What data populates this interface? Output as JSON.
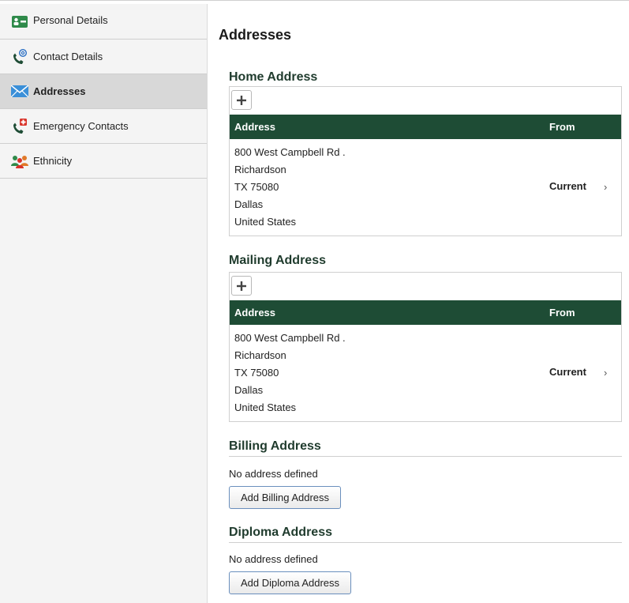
{
  "sidebar": {
    "items": [
      {
        "label": "Personal Details",
        "icon": "id-card-icon"
      },
      {
        "label": "Contact Details",
        "icon": "phone-at-icon"
      },
      {
        "label": "Addresses",
        "icon": "envelope-icon",
        "active": true
      },
      {
        "label": "Emergency Contacts",
        "icon": "phone-emergency-icon"
      },
      {
        "label": "Ethnicity",
        "icon": "people-icon"
      }
    ]
  },
  "main": {
    "title": "Addresses",
    "home": {
      "title": "Home Address",
      "col_address": "Address",
      "col_from": "From",
      "lines": [
        "800 West Campbell Rd .",
        "Richardson",
        "TX 75080",
        "Dallas",
        "United States"
      ],
      "from": "Current"
    },
    "mailing": {
      "title": "Mailing Address",
      "col_address": "Address",
      "col_from": "From",
      "lines": [
        "800 West Campbell Rd .",
        "Richardson",
        "TX 75080",
        "Dallas",
        "United States"
      ],
      "from": "Current"
    },
    "billing": {
      "title": "Billing Address",
      "empty_text": "No address defined",
      "button": "Add Billing Address"
    },
    "diploma": {
      "title": "Diploma Address",
      "empty_text": "No address defined",
      "button": "Add Diploma Address"
    }
  },
  "colors": {
    "header_green": "#1e4c35",
    "title_green": "#1f3b2d",
    "sidebar_bg": "#f4f4f4",
    "active_bg": "#d8d8d8"
  }
}
